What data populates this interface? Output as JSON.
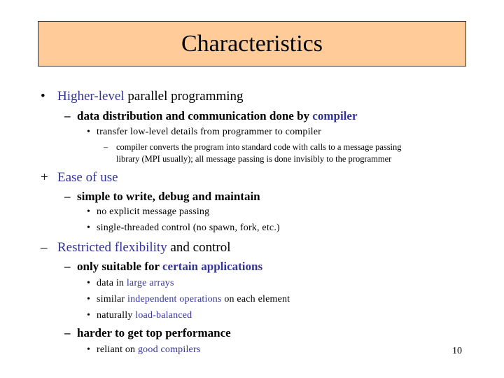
{
  "title": "Characteristics",
  "page_number": "10",
  "bullets": {
    "b1": {
      "marker": "•",
      "hl": "Higher-level",
      "rest": " parallel programming"
    },
    "b1_1": {
      "marker": "–",
      "text": "data distribution and communication done by ",
      "hl": "compiler"
    },
    "b1_1_1": {
      "marker": "•",
      "text": "transfer low-level details from programmer to compiler"
    },
    "b1_1_1_1": {
      "marker": "–",
      "text_line1": "compiler converts the program into standard code with calls to a message passing",
      "text_line2": "library (MPI usually); all message passing is done invisibly to the programmer"
    },
    "b2": {
      "marker": "+",
      "hl": "Ease of use"
    },
    "b2_1": {
      "marker": "–",
      "text": "simple to write, debug and maintain"
    },
    "b2_1_1": {
      "marker": "•",
      "text": "no explicit message passing"
    },
    "b2_1_2": {
      "marker": "•",
      "text": "single-threaded control (no spawn, fork, etc.)"
    },
    "b3": {
      "marker": "–",
      "hl": "Restricted flexibility",
      "rest": " and control"
    },
    "b3_1": {
      "marker": "–",
      "text": "only suitable for ",
      "hl": "certain applications"
    },
    "b3_1_1": {
      "marker": "•",
      "text": "data in ",
      "hl": "large arrays"
    },
    "b3_1_2": {
      "marker": "•",
      "text": "similar ",
      "hl": "independent operations",
      "rest": " on each element"
    },
    "b3_1_3": {
      "marker": "•",
      "text": "naturally ",
      "hl": "load-balanced"
    },
    "b3_2": {
      "marker": "–",
      "text": "harder to get top performance"
    },
    "b3_2_1": {
      "marker": "•",
      "text": "reliant on ",
      "hl": "good compilers"
    }
  },
  "colors": {
    "title_bg": "#ffcc99",
    "highlight": "#333399"
  }
}
